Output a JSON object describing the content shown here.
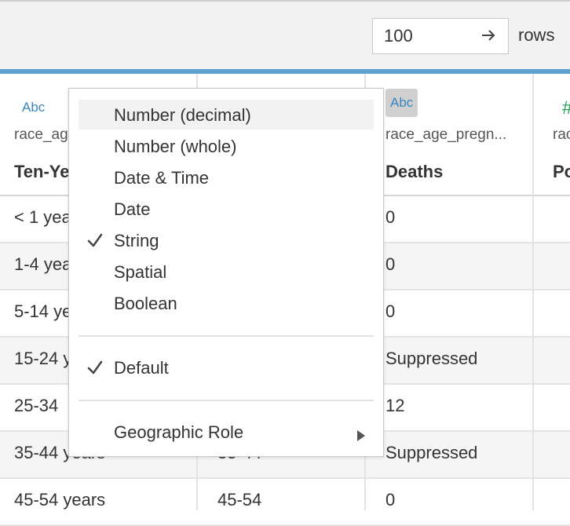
{
  "toolbar": {
    "rows_value": "100",
    "rows_label": "rows",
    "arrow_icon": "arrow-right-icon"
  },
  "table": {
    "columns": [
      {
        "type_label": "Abc",
        "source": "race_ag",
        "field": "Ten-Ye"
      },
      {
        "type_label": "",
        "source": "",
        "field": ""
      },
      {
        "type_label": "Abc",
        "source": "race_age_pregn...",
        "field": "Deaths"
      },
      {
        "type_label": "#",
        "source": "rac",
        "field": "Po"
      }
    ],
    "rows": [
      {
        "c0": "< 1 yea",
        "c1": "",
        "c2": "0"
      },
      {
        "c0": "1-4 yea",
        "c1": "",
        "c2": "0"
      },
      {
        "c0": "5-14 ye",
        "c1": "",
        "c2": "0"
      },
      {
        "c0": "15-24 y",
        "c1": "",
        "c2": "Suppressed"
      },
      {
        "c0": "25-34",
        "c1": "",
        "c2": "12"
      },
      {
        "c0": "35-44 years",
        "c1": "35-44",
        "c2": "Suppressed"
      },
      {
        "c0": "45-54 years",
        "c1": "45-54",
        "c2": "0"
      }
    ]
  },
  "menu": {
    "type_items": [
      {
        "label": "Number (decimal)",
        "checked": false,
        "highlighted": true
      },
      {
        "label": "Number (whole)",
        "checked": false,
        "highlighted": false
      },
      {
        "label": "Date & Time",
        "checked": false,
        "highlighted": false
      },
      {
        "label": "Date",
        "checked": false,
        "highlighted": false
      },
      {
        "label": "String",
        "checked": true,
        "highlighted": false
      },
      {
        "label": "Spatial",
        "checked": false,
        "highlighted": false
      },
      {
        "label": "Boolean",
        "checked": false,
        "highlighted": false
      }
    ],
    "default_item": {
      "label": "Default",
      "checked": true
    },
    "geo_item": {
      "label": "Geographic Role"
    }
  },
  "colors": {
    "accent_bar": "#5fa0d0",
    "type_blue": "#3a86ba",
    "measure_green": "#2aa05a"
  }
}
